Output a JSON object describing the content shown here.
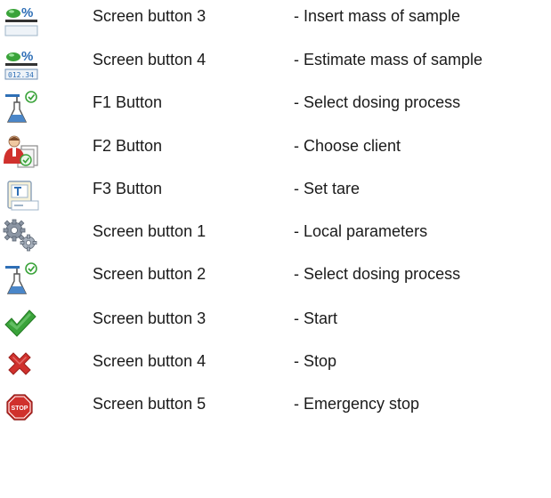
{
  "rows": [
    {
      "icon": "percent-mass-icon",
      "button": "Screen button 3",
      "description": "- Insert mass of sample"
    },
    {
      "icon": "percent-display-icon",
      "button": "Screen button 4",
      "description": "- Estimate mass of sample"
    },
    {
      "icon": "flask-check-icon",
      "button": "F1 Button",
      "description": "- Select dosing process"
    },
    {
      "icon": "client-icon",
      "button": "F2 Button",
      "description": "- Choose client"
    },
    {
      "icon": "tare-icon",
      "button": "F3 Button",
      "description": "- Set tare"
    },
    {
      "icon": "gears-icon",
      "button": "Screen button 1",
      "description": "- Local parameters"
    },
    {
      "icon": "flask-check-icon",
      "button": "Screen button 2",
      "description": "- Select dosing process"
    },
    {
      "icon": "checkmark-icon",
      "button": "Screen button 3",
      "description": "- Start"
    },
    {
      "icon": "cross-icon",
      "button": "Screen button 4",
      "description": "- Stop"
    },
    {
      "icon": "stop-sign-icon",
      "button": "Screen button 5",
      "description": "- Emergency stop"
    }
  ],
  "icon_glyphs": {
    "percent": "%",
    "display_digits": "012.34",
    "stop_text": "STOP"
  },
  "colors": {
    "green": "#3aa33a",
    "red": "#d0312d",
    "blue": "#2e6fb6",
    "text": "#1a1a1a"
  }
}
